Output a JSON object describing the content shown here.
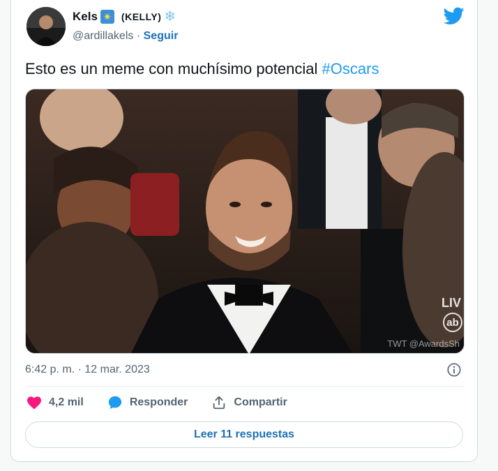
{
  "author": {
    "display_name": "Kels",
    "name_tag": "(KELLY)",
    "handle": "@ardillakels",
    "separator": "·",
    "follow_label": "Seguir"
  },
  "tweet": {
    "text": "Esto es un meme con muchísimo potencial ",
    "hashtag": "#Oscars",
    "timestamp": "6:42 p. m. · 12 mar. 2023"
  },
  "media": {
    "live_label": "LIV",
    "network_label": "ab",
    "watermark": "TWT @AwardsSh"
  },
  "actions": {
    "likes_count": "4,2 mil",
    "reply_label": "Responder",
    "share_label": "Compartir"
  },
  "footer": {
    "read_replies_label": "Leer 11 respuestas"
  },
  "colors": {
    "brand": "#1d9bf0",
    "link": "#1d70b8",
    "like": "#f91880",
    "muted": "#536471"
  }
}
